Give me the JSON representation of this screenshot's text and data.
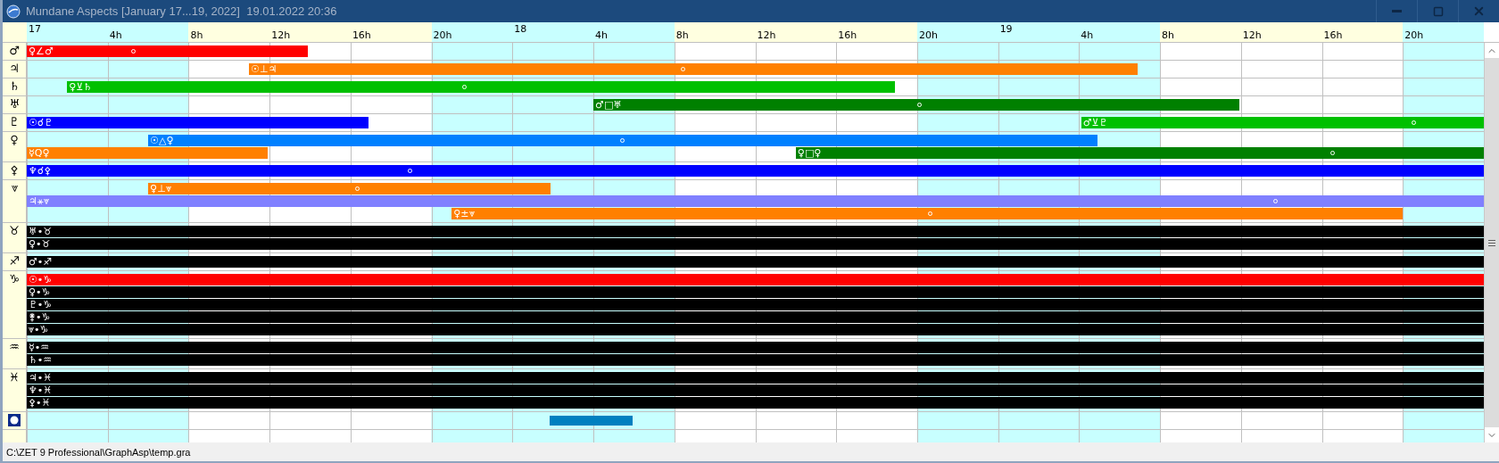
{
  "window": {
    "title": "Mundane Aspects [January 17...19, 2022]  19.01.2022 20:36"
  },
  "header": {
    "ticks": [
      {
        "label": "17",
        "kind": "day"
      },
      {
        "label": "4h",
        "kind": "hour"
      },
      {
        "label": "8h",
        "kind": "hour"
      },
      {
        "label": "12h",
        "kind": "hour"
      },
      {
        "label": "16h",
        "kind": "hour"
      },
      {
        "label": "20h",
        "kind": "hour"
      },
      {
        "label": "18",
        "kind": "day"
      },
      {
        "label": "4h",
        "kind": "hour"
      },
      {
        "label": "8h",
        "kind": "hour"
      },
      {
        "label": "12h",
        "kind": "hour"
      },
      {
        "label": "16h",
        "kind": "hour"
      },
      {
        "label": "20h",
        "kind": "hour"
      },
      {
        "label": "19",
        "kind": "day"
      },
      {
        "label": "4h",
        "kind": "hour"
      },
      {
        "label": "8h",
        "kind": "hour"
      },
      {
        "label": "12h",
        "kind": "hour"
      },
      {
        "label": "16h",
        "kind": "hour"
      },
      {
        "label": "20h",
        "kind": "hour"
      }
    ]
  },
  "groups": [
    {
      "kind": "glyph",
      "glyph": "♂",
      "rows": [
        [
          {
            "label": "♀∠♂",
            "color": "#ff0000"
          }
        ]
      ]
    },
    {
      "kind": "glyph",
      "glyph": "♃",
      "rows": [
        [
          {
            "label": "☉⊥♃",
            "color": "#ff8000"
          }
        ]
      ]
    },
    {
      "kind": "glyph",
      "glyph": "♄",
      "rows": [
        [
          {
            "label": "♀⊻♄",
            "color": "#00c000"
          }
        ]
      ]
    },
    {
      "kind": "glyph",
      "glyph": "♅",
      "rows": [
        [
          {
            "label": "♂□♅",
            "color": "#008000"
          }
        ]
      ]
    },
    {
      "kind": "glyph",
      "glyph": "♇",
      "rows": [
        [
          {
            "label": "☉☌♇",
            "color": "#0000ff"
          },
          {
            "label": "♂⊻♇",
            "color": "#00c000"
          }
        ]
      ]
    },
    {
      "kind": "glyph",
      "glyph": "♀",
      "rows": [
        [
          {
            "label": "☉△♀",
            "color": "#0080ff"
          }
        ],
        [
          {
            "label": "☿Q♀",
            "color": "#ff8000"
          },
          {
            "label": "♀□♀",
            "color": "#008000"
          }
        ]
      ]
    },
    {
      "kind": "glyph",
      "glyph": "⚴",
      "rows": [
        [
          {
            "label": "♆☌⚴",
            "color": "#0000ff"
          }
        ]
      ]
    },
    {
      "kind": "glyph",
      "glyph": "⩔",
      "rows": [
        [
          {
            "label": "♀⊥⩔",
            "color": "#ff8000"
          }
        ],
        [
          {
            "label": "♃⚹⩔",
            "color": "#8080ff"
          }
        ],
        [
          {
            "label": "♀±⩔",
            "color": "#ff8000"
          }
        ]
      ]
    },
    {
      "kind": "glyph",
      "glyph": "♉",
      "rows": [
        [
          {
            "label": "♅•♉",
            "color": "#000000"
          }
        ],
        [
          {
            "label": "♀•♉",
            "color": "#000000"
          }
        ]
      ]
    },
    {
      "kind": "glyph",
      "glyph": "♐",
      "rows": [
        [
          {
            "label": "♂•♐",
            "color": "#000000"
          }
        ]
      ]
    },
    {
      "kind": "glyph",
      "glyph": "♑",
      "rows": [
        [
          {
            "label": "☉•♑",
            "color": "#ff0000"
          }
        ],
        [
          {
            "label": "♀•♑",
            "color": "#000000"
          }
        ],
        [
          {
            "label": "♇•♑",
            "color": "#000000"
          }
        ],
        [
          {
            "label": "⚵•♑",
            "color": "#000000"
          }
        ],
        [
          {
            "label": "⩔•♑",
            "color": "#000000"
          }
        ]
      ]
    },
    {
      "kind": "glyph",
      "glyph": "♒",
      "rows": [
        [
          {
            "label": "☿•♒",
            "color": "#000000"
          }
        ],
        [
          {
            "label": "♄•♒",
            "color": "#000000"
          }
        ]
      ]
    },
    {
      "kind": "glyph",
      "glyph": "♓",
      "rows": [
        [
          {
            "label": "♃•♓",
            "color": "#000000"
          }
        ],
        [
          {
            "label": "♆•♓",
            "color": "#000000"
          }
        ],
        [
          {
            "label": "⚴•♓",
            "color": "#000000"
          }
        ]
      ]
    },
    {
      "kind": "icon",
      "rows": [
        [
          {
            "color": "#0080c0"
          }
        ]
      ]
    },
    {
      "kind": "blank"
    }
  ],
  "status_bar": {
    "path": "C:\\ZET 9 Professional\\GraphAsp\\temp.gra"
  }
}
